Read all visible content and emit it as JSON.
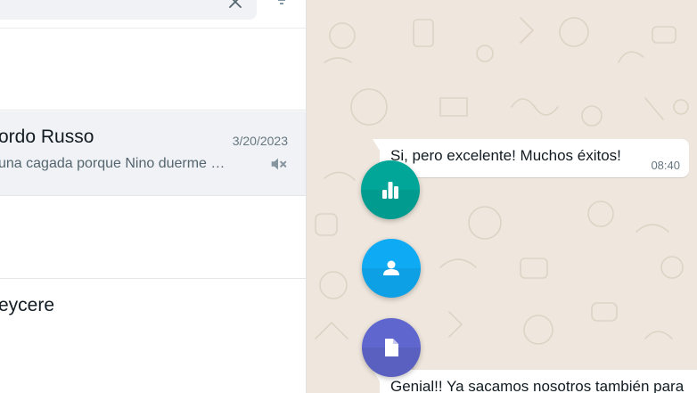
{
  "chat_list": {
    "items": [
      {
        "name": "ordo Russo",
        "time": "3/20/2023",
        "preview": "una cagada porque Nino duerme …",
        "muted": true,
        "selected": true
      },
      {
        "name": "eycere",
        "time": "",
        "preview": "",
        "muted": false,
        "selected": false
      }
    ]
  },
  "conversation": {
    "messages": [
      {
        "text": "Si, pero excelente! Muchos éxitos!",
        "time": "08:40",
        "direction": "incoming"
      },
      {
        "text": "Genial!! Ya sacamos nosotros también para",
        "time": "",
        "direction": "incoming"
      }
    ]
  },
  "attach_menu": {
    "items": [
      {
        "icon": "poll-icon",
        "color": "#02a698"
      },
      {
        "icon": "contact-icon",
        "color": "#0eabf4"
      },
      {
        "icon": "document-icon",
        "color": "#5f66cd"
      }
    ]
  },
  "colors": {
    "wallpaper": "#efe7dd",
    "selected_row": "#f0f2f5",
    "secondary_text": "#667781"
  }
}
